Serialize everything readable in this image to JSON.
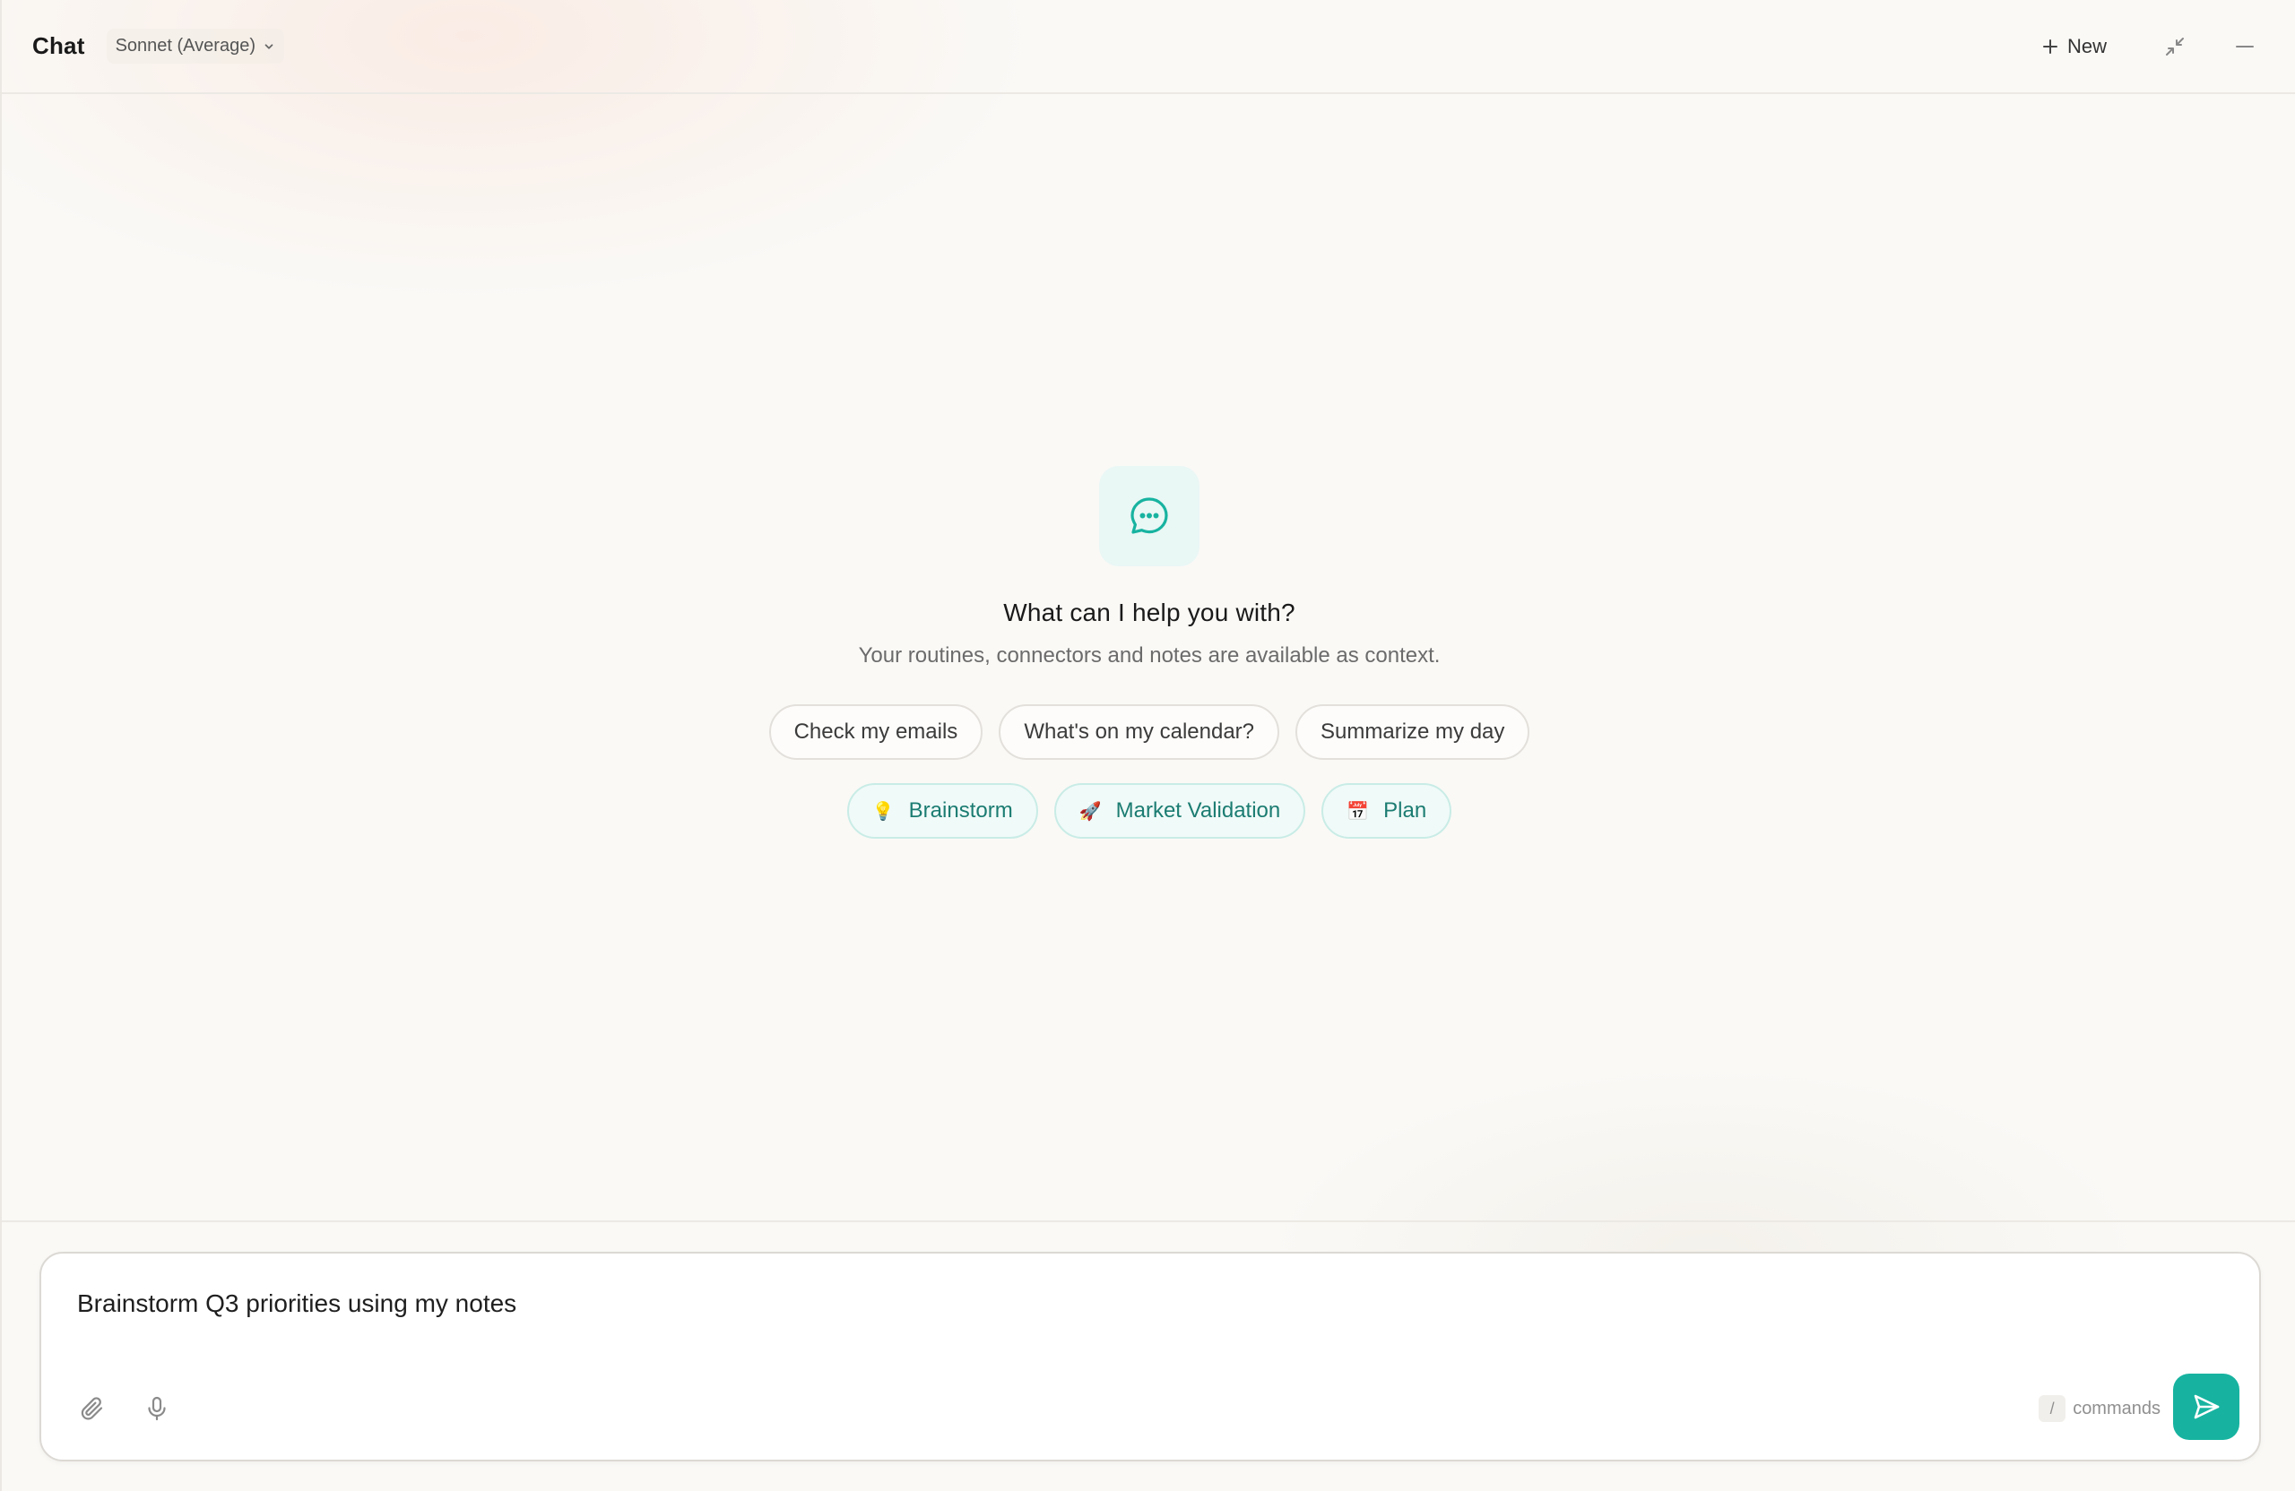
{
  "header": {
    "title": "Chat",
    "model_label": "Sonnet (Average)",
    "new_label": "New"
  },
  "icons": {
    "model_dropdown": "chevron-down-icon",
    "new": "plus-icon",
    "collapse": "collapse-arrows-icon",
    "minimize": "minus-icon",
    "chat": "chat-bubble-dots-icon",
    "attach": "paperclip-icon",
    "mic": "microphone-icon",
    "send": "send-icon"
  },
  "empty_state": {
    "heading": "What can I help you with?",
    "subheading": "Your routines, connectors and notes are available as context."
  },
  "suggestions": [
    {
      "label": "Check my emails"
    },
    {
      "label": "What's on my calendar?"
    },
    {
      "label": "Summarize my day"
    }
  ],
  "modes": [
    {
      "emoji": "💡",
      "label": "Brainstorm"
    },
    {
      "emoji": "🚀",
      "label": "Market Validation"
    },
    {
      "emoji": "📅",
      "label": "Plan"
    }
  ],
  "composer": {
    "value": "Brainstorm Q3 priorities using my notes",
    "commands_key": "/",
    "commands_label": "commands"
  },
  "colors": {
    "accent": "#17b3a0",
    "accent_text": "#1b7c72",
    "background": "#faf9f6"
  }
}
